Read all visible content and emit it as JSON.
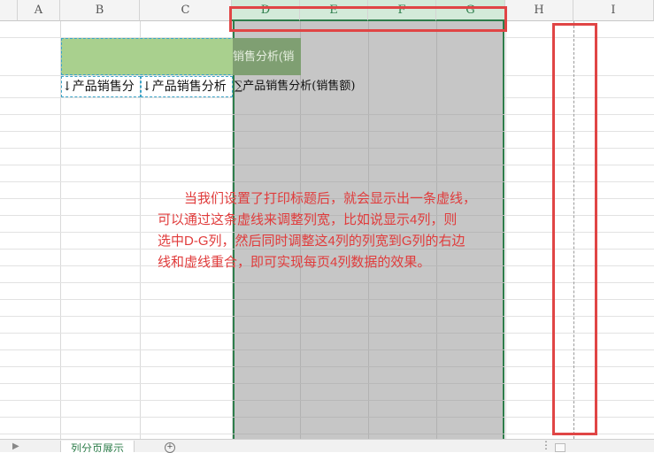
{
  "columns": [
    {
      "id": "corner",
      "label": ""
    },
    {
      "id": "A",
      "label": "A"
    },
    {
      "id": "B",
      "label": "B"
    },
    {
      "id": "C",
      "label": "C"
    },
    {
      "id": "D",
      "label": "D"
    },
    {
      "id": "E",
      "label": "E"
    },
    {
      "id": "F",
      "label": "F"
    },
    {
      "id": "G",
      "label": "G"
    },
    {
      "id": "H",
      "label": "H"
    },
    {
      "id": "I",
      "label": "I"
    }
  ],
  "pivot": {
    "title": "销售分析(销",
    "fields": [
      "↓产品销售分",
      "↓产品销售分析",
      "∑产品销售分析(销售额)"
    ]
  },
  "annotation": {
    "lines": [
      "当我们设置了打印标题后，就会显示出一条虚线，",
      "可以通过这条虚线来调整列宽，比如说显示4列，则",
      "选中D-G列，然后同时调整这4列的列宽到G列的右边",
      "线和虚线重合，即可实现每页4列数据的效果。"
    ]
  },
  "tabs": {
    "sheet_name": "列分页展示",
    "add_symbol": "+",
    "prev_symbol": "▶",
    "more_symbol": "⋮"
  },
  "colors": {
    "selection_border": "#2e7d4b",
    "selection_fill": "#c6c6c6",
    "pivot_header_fill": "#a9d08e",
    "highlight_red": "#e04545",
    "annotation_text": "#e03c3c"
  }
}
